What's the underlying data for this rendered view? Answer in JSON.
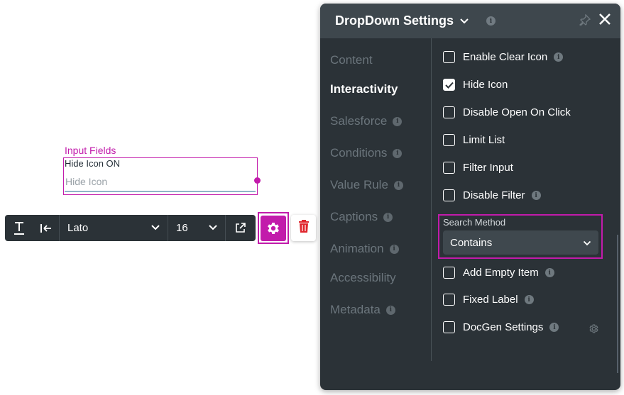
{
  "canvas": {
    "component_label": "Input Fields",
    "field_title": "Hide Icon ON",
    "field_placeholder": "Hide Icon"
  },
  "toolbar": {
    "font_family": "Lato",
    "font_size": "16",
    "icons": [
      "text-format-icon",
      "align-left-icon",
      "chevron-down-icon",
      "external-link-icon",
      "gear-icon",
      "trash-icon"
    ]
  },
  "panel": {
    "title": "DropDown Settings",
    "nav": [
      {
        "label": "Content",
        "active": false,
        "info": false
      },
      {
        "label": "Interactivity",
        "active": true,
        "info": false
      },
      {
        "label": "Salesforce",
        "active": false,
        "info": true
      },
      {
        "label": "Conditions",
        "active": false,
        "info": true
      },
      {
        "label": "Value Rule",
        "active": false,
        "info": true
      },
      {
        "label": "Captions",
        "active": false,
        "info": true
      },
      {
        "label": "Animation",
        "active": false,
        "info": true
      },
      {
        "label": "Accessibility",
        "active": false,
        "info": false
      },
      {
        "label": "Metadata",
        "active": false,
        "info": true
      }
    ],
    "options": [
      {
        "label": "Enable Clear Icon",
        "checked": false,
        "info": true
      },
      {
        "label": "Hide Icon",
        "checked": true,
        "info": false
      },
      {
        "label": "Disable Open On Click",
        "checked": false,
        "info": false
      },
      {
        "label": "Limit List",
        "checked": false,
        "info": false
      },
      {
        "label": "Filter Input",
        "checked": false,
        "info": false
      },
      {
        "label": "Disable Filter",
        "checked": false,
        "info": true
      },
      {
        "label": "Add Empty Item",
        "checked": false,
        "info": true
      },
      {
        "label": "Fixed Label",
        "checked": false,
        "info": true
      },
      {
        "label": "DocGen Settings",
        "checked": false,
        "info": true
      }
    ],
    "search_method": {
      "label": "Search Method",
      "value": "Contains"
    },
    "info_glyph": "i"
  },
  "colors": {
    "accent": "#c21bab",
    "panel_bg": "#2b3237",
    "panel_header_bg": "#3e474d",
    "trash_red": "#e0262d"
  }
}
